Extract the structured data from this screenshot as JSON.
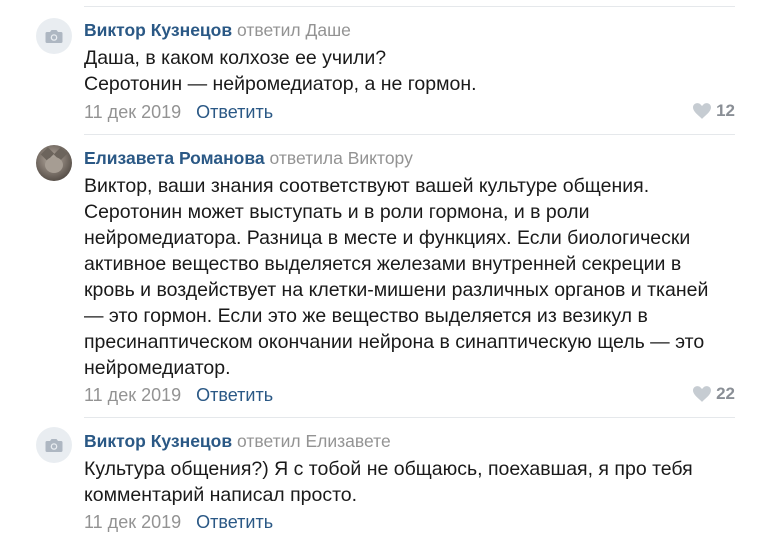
{
  "comments": [
    {
      "author": "Виктор Кузнецов",
      "reply_to": "ответил Даше",
      "lines": [
        "Даша, в каком колхозе ее учили?",
        "Серотонин — нейромедиатор, а не гормон."
      ],
      "date": "11 дек 2019",
      "reply_label": "Ответить",
      "likes": "12",
      "avatar": "camera-placeholder"
    },
    {
      "author": "Елизавета Романова",
      "reply_to": "ответила Виктору",
      "lines": [
        "Виктор, ваши знания соответствуют вашей культуре общения.",
        "Серотонин может выступать и в роли гормона, и в роли",
        "нейромедиатора. Разница в месте и функциях. Если биологически",
        "активное вещество выделяется железами внутренней секреции в",
        "кровь и воздействует на клетки-мишени различных органов и тканей",
        "— это гормон. Если это же вещество выделяется из везикул в",
        "пресинаптическом окончании нейрона в синаптическую щель — это",
        "нейромедиатор."
      ],
      "date": "11 дек 2019",
      "reply_label": "Ответить",
      "likes": "22",
      "avatar": "cat-photo"
    },
    {
      "author": "Виктор Кузнецов",
      "reply_to": "ответил Елизавете",
      "lines": [
        "Культура общения?) Я с тобой не общаюсь, поехавшая, я про тебя",
        "комментарий написал просто."
      ],
      "date": "11 дек 2019",
      "reply_label": "Ответить",
      "avatar": "camera-placeholder"
    }
  ],
  "colors": {
    "author": "#2a5885",
    "muted": "#939393",
    "text": "#1a1a1a",
    "divider": "#e5e8eb"
  }
}
